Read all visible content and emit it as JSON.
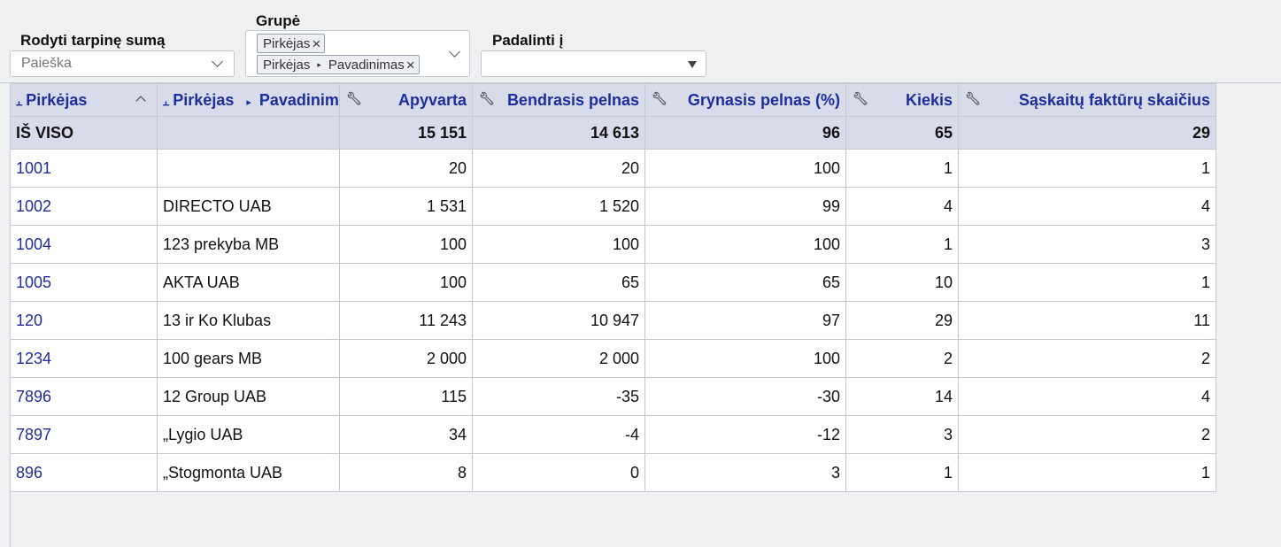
{
  "controls": {
    "subtotal_label": "Rodyti tarpinę sumą",
    "search_placeholder": "Paieška",
    "group_label": "Grupė",
    "group_chips": [
      {
        "parts": [
          "Pirkėjas"
        ]
      },
      {
        "parts": [
          "Pirkėjas",
          "Pavadinimas"
        ]
      }
    ],
    "chip_separator": "▸",
    "chip_remove": "×",
    "split_label": "Padalinti į",
    "split_value": ""
  },
  "table": {
    "headers": [
      {
        "label": "Pirkėjas",
        "pinned": true
      },
      {
        "label_a": "Pirkėjas",
        "sep": "▸",
        "label_b": "Pavadinimas",
        "pinned": true
      },
      {
        "label": "Apyvarta"
      },
      {
        "label": "Bendrasis pelnas"
      },
      {
        "label": "Grynasis pelnas (%)"
      },
      {
        "label": "Kiekis"
      },
      {
        "label": "Sąskaitų faktūrų skaičius"
      }
    ],
    "total": {
      "label": "IŠ VISO",
      "name": "",
      "apyvarta": "15 151",
      "bendrasis": "14 613",
      "grynasis": "96",
      "kiekis": "65",
      "saskaitos": "29"
    },
    "rows": [
      {
        "id": "1001",
        "name": "",
        "apyvarta": "20",
        "bendrasis": "20",
        "grynasis": "100",
        "kiekis": "1",
        "saskaitos": "1"
      },
      {
        "id": "1002",
        "name": "DIRECTO UAB",
        "apyvarta": "1 531",
        "bendrasis": "1 520",
        "grynasis": "99",
        "kiekis": "4",
        "saskaitos": "4"
      },
      {
        "id": "1004",
        "name": "123 prekyba MB",
        "apyvarta": "100",
        "bendrasis": "100",
        "grynasis": "100",
        "kiekis": "1",
        "saskaitos": "3"
      },
      {
        "id": "1005",
        "name": "AKTA UAB",
        "apyvarta": "100",
        "bendrasis": "65",
        "grynasis": "65",
        "kiekis": "10",
        "saskaitos": "1"
      },
      {
        "id": "120",
        "name": "13 ir Ko Klubas",
        "apyvarta": "11 243",
        "bendrasis": "10 947",
        "grynasis": "97",
        "kiekis": "29",
        "saskaitos": "11"
      },
      {
        "id": "1234",
        "name": "100 gears MB",
        "apyvarta": "2 000",
        "bendrasis": "2 000",
        "grynasis": "100",
        "kiekis": "2",
        "saskaitos": "2"
      },
      {
        "id": "7896",
        "name": "12 Group UAB",
        "apyvarta": "115",
        "bendrasis": "-35",
        "grynasis": "-30",
        "kiekis": "14",
        "saskaitos": "4"
      },
      {
        "id": "7897",
        "name": "„Lygio UAB",
        "apyvarta": "34",
        "bendrasis": "-4",
        "grynasis": "-12",
        "kiekis": "3",
        "saskaitos": "2"
      },
      {
        "id": "896",
        "name": "„Stogmonta UAB",
        "apyvarta": "8",
        "bendrasis": "0",
        "grynasis": "3",
        "kiekis": "1",
        "saskaitos": "1"
      }
    ]
  },
  "icons": {
    "pin": "pin-icon",
    "wrench": "wrench-icon",
    "sort": "sort-ascending-icon",
    "dropdown": "chevron-down-icon"
  },
  "colors": {
    "header_bg": "#d8dcea",
    "link_blue": "#1e2d9c",
    "page_bg": "#eef0f2"
  }
}
